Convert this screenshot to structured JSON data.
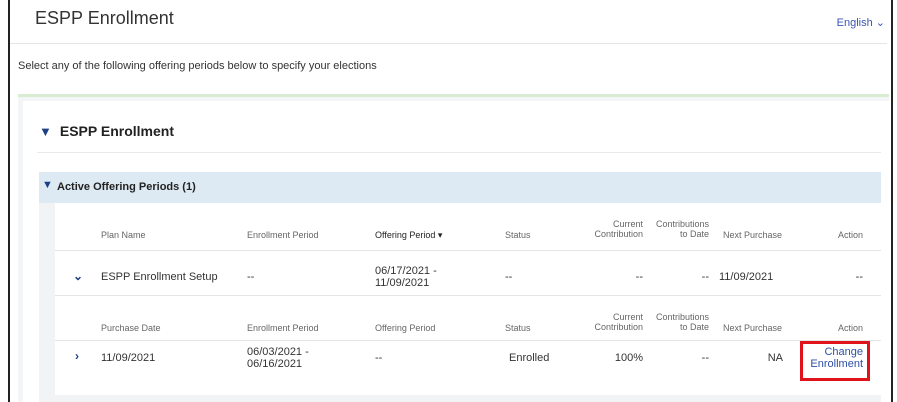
{
  "header": {
    "title": "ESPP Enrollment",
    "language": "English ⌄"
  },
  "instructions": "Select any of the following offering periods below to specify your elections",
  "section": {
    "title": "ESPP Enrollment",
    "chevron": "chevron-down-icon"
  },
  "active_periods": {
    "label": "Active Offering Periods (1)"
  },
  "plan_table": {
    "columns": [
      "Plan Name",
      "Enrollment Period",
      "Offering Period ▾",
      "Status",
      "Current Contribution",
      "Contributions to Date",
      "Next Purchase",
      "Action"
    ],
    "row": {
      "plan_name": "ESPP Enrollment Setup",
      "enrollment_period": "--",
      "offering_period": "06/17/2021 - 11/09/2021",
      "status": "--",
      "current_contribution": "--",
      "contributions_to_date": "--",
      "next_purchase": "11/09/2021",
      "action": "--"
    }
  },
  "purchase_table": {
    "columns": [
      "Purchase Date",
      "Enrollment Period",
      "Offering Period",
      "Status",
      "Current Contribution",
      "Contributions to Date",
      "Next Purchase",
      "Action"
    ],
    "row": {
      "purchase_date": "11/09/2021",
      "enrollment_period": "06/03/2021 - 06/16/2021",
      "offering_period": "--",
      "status": "Enrolled",
      "current_contribution": "100%",
      "contributions_to_date": "--",
      "next_purchase": "NA",
      "action": "Change Enrollment"
    }
  },
  "colors": {
    "accent": "#2c4fa4",
    "highlight": "#e0131a",
    "section_bg": "#deeaf3"
  }
}
